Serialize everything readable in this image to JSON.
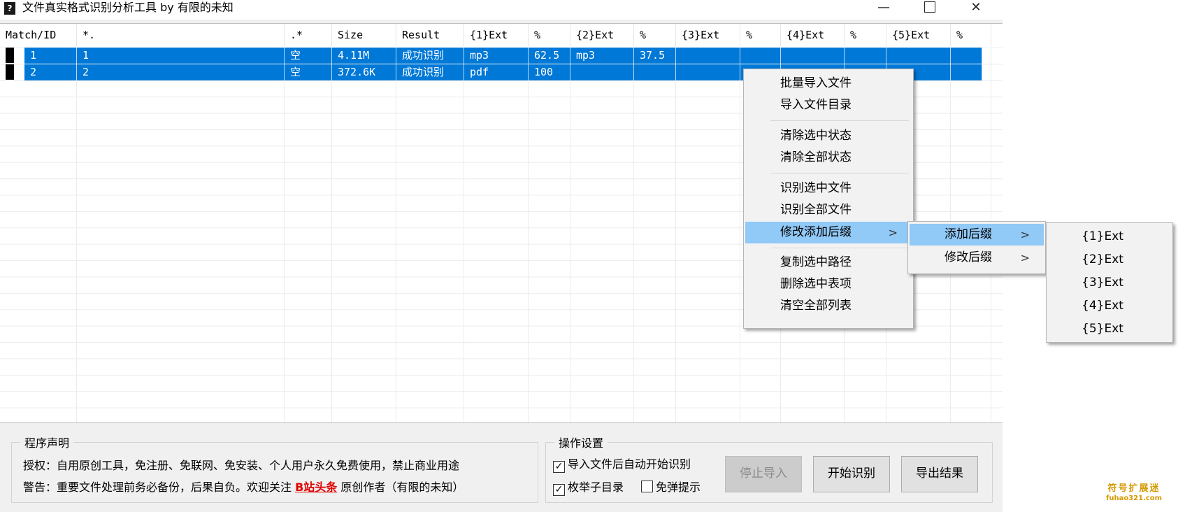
{
  "window": {
    "title": "文件真实格式识别分析工具 by 有限的未知",
    "icon": "question-app-icon",
    "controls": {
      "minimize": "—",
      "close": "✕"
    }
  },
  "table": {
    "columns": [
      "Match/ID",
      "*.",
      ".*",
      "Size",
      "Result",
      "{1}Ext",
      "%",
      "{2}Ext",
      "%",
      "{3}Ext",
      "%",
      "{4}Ext",
      "%",
      "{5}Ext",
      "%"
    ],
    "rows": [
      [
        "1",
        "1",
        "空",
        "4.11M",
        "成功识别",
        "mp3",
        "62.5",
        "mp3",
        "37.5",
        "",
        "",
        "",
        "",
        "",
        ""
      ],
      [
        "2",
        "2",
        "空",
        "372.6K",
        "成功识别",
        "pdf",
        "100",
        "",
        "",
        "",
        "",
        "",
        "",
        "",
        ""
      ]
    ],
    "selection_color": "#0078d7"
  },
  "statement": {
    "title": "程序声明",
    "license_line": "授权：自用原创工具，免注册、免联网、免安装、个人用户永久免费使用，禁止商业用途",
    "warning_prefix": "警告：重要文件处理前务必备份，后果自负。欢迎关注",
    "link_bilibili": "B站",
    "link_toutiao": "头条",
    "warning_suffix": "原创作者（有限的未知）"
  },
  "settings": {
    "title": "操作设置",
    "auto_start": {
      "label": "导入文件后自动开始识别",
      "checked": true
    },
    "enum_subdirs": {
      "label": "枚举子目录",
      "checked": true
    },
    "no_popup": {
      "label": "免弹提示",
      "checked": false
    }
  },
  "buttons": {
    "stop_import": "停止导入",
    "start": "开始识别",
    "export": "导出结果"
  },
  "context_menu": {
    "items": [
      "批量导入文件",
      "导入文件目录",
      "清除选中状态",
      "清除全部状态",
      "识别选中文件",
      "识别全部文件",
      "修改添加后缀",
      "复制选中路径",
      "删除选中表项",
      "清空全部列表"
    ],
    "highlighted": "修改添加后缀"
  },
  "submenu": {
    "items": [
      "添加后缀",
      "修改后缀"
    ],
    "highlighted": "添加后缀"
  },
  "submenu2": {
    "items": [
      "{1}Ext",
      "{2}Ext",
      "{3}Ext",
      "{4}Ext",
      "{5}Ext"
    ]
  },
  "watermark": {
    "line1": "符号扩展迷",
    "line2": "fuhao321.com"
  }
}
